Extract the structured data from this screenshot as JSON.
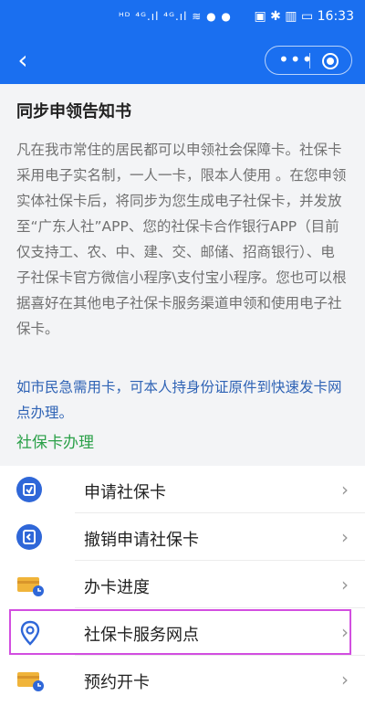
{
  "status": {
    "left_icons": "ᴴᴰ ⁴ᴳ.ıl ⁴ᴳ.ıl ≋ ● ●",
    "right_info": "▣ ✱ ▥ ▭ 16:33"
  },
  "nav": {
    "back_icon": "back-icon",
    "more_icon": "more-icon",
    "close_icon": "target-icon"
  },
  "notice": {
    "title": "同步申领告知书",
    "body": "凡在我市常住的居民都可以申领社会保障卡。社保卡采用电子实名制，一人一卡，限本人使用 。在您申领实体社保卡后，将同步为您生成电子社保卡，并发放至“广东人社”APP、您的社保卡合作银行APP（目前仅支持工、农、中、建、交、邮储、招商银行）、电子社保卡官方微信小程序\\支付宝小程序。您也可以根据喜好在其他电子社保卡服务渠道申领和使用电子社保卡。",
    "tip": "如市民急需用卡，可本人持身份证原件到快速发卡网点办理。",
    "section": "社保卡办理"
  },
  "menu": [
    {
      "label": "申请社保卡",
      "icon": "apply-card-icon"
    },
    {
      "label": "撤销申请社保卡",
      "icon": "cancel-apply-icon"
    },
    {
      "label": "办卡进度",
      "icon": "progress-icon"
    },
    {
      "label": "社保卡服务网点",
      "icon": "location-icon"
    },
    {
      "label": "预约开卡",
      "icon": "appointment-icon"
    }
  ],
  "colors": {
    "primary": "#1a6ff0",
    "section": "#2aa048",
    "tip": "#2f63b5",
    "highlight": "#d24ee0"
  }
}
